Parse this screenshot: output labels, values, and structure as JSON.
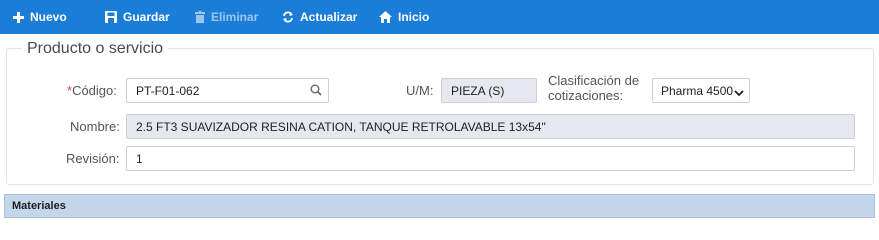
{
  "toolbar": {
    "nuevo": "Nuevo",
    "guardar": "Guardar",
    "eliminar": "Eliminar",
    "actualizar": "Actualizar",
    "inicio": "Inicio"
  },
  "form": {
    "legend": "Producto o servicio",
    "codigo_required_mark": "*",
    "codigo_label": "Código:",
    "codigo_value": "PT-F01-062",
    "um_label": "U/M:",
    "um_value": "PIEZA (S)",
    "clasificacion_label_line1": "Clasificación de",
    "clasificacion_label_line2": "cotizaciones:",
    "clasificacion_value": "Pharma 4500",
    "nombre_label": "Nombre:",
    "nombre_value": "2.5 FT3 SUAVIZADOR RESINA CATION, TANQUE RETROLAVABLE 13x54\"",
    "revision_label": "Revisión:",
    "revision_value": "1"
  },
  "materiales": {
    "title": "Materiales"
  },
  "colors": {
    "toolbar_bg": "#1a7ed9",
    "readonly_bg": "#e5e8ef",
    "section_bg": "#c4d6ec",
    "required": "#e04343"
  },
  "icons": [
    "plus-icon",
    "save-icon",
    "trash-icon",
    "refresh-icon",
    "home-icon",
    "search-icon",
    "chevron-down-icon"
  ]
}
